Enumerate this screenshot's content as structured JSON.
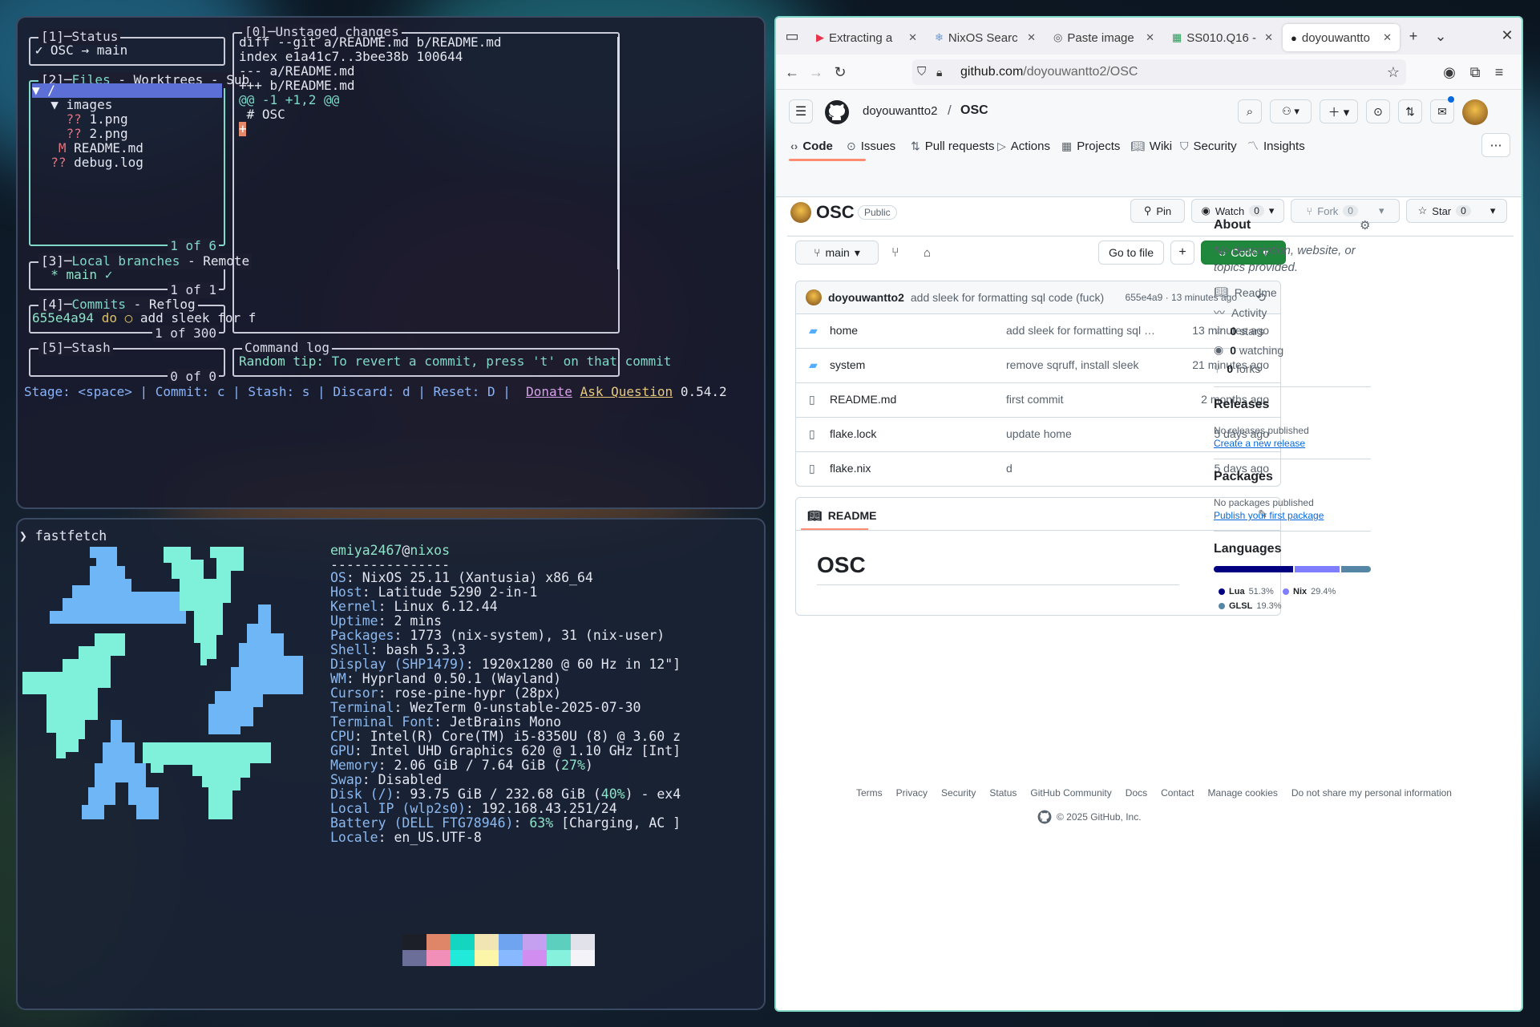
{
  "lazygit": {
    "status": {
      "title": "[1]─Status",
      "value": "✓ OSC → main"
    },
    "files": {
      "title_num": "[2]─",
      "title_active": "Files",
      "title_rest": " - Worktrees - Sub",
      "rows": [
        {
          "text": "▼ /",
          "cls": "sel"
        },
        {
          "text": "  ▼ images",
          "cls": "wh"
        },
        {
          "prefix": "    ?? ",
          "name": "1.png"
        },
        {
          "prefix": "    ?? ",
          "name": "2.png"
        },
        {
          "prefix": "   M ",
          "name": "README.md"
        },
        {
          "prefix": "  ?? ",
          "name": "debug.log"
        }
      ],
      "footer": "1 of 6"
    },
    "branches": {
      "title_num": "[3]─",
      "title_active": "Local branches",
      "title_rest": " - Remote",
      "row": "  * main ✓",
      "footer": "1 of 1"
    },
    "commits": {
      "title_num": "[4]─",
      "title_active": "Commits",
      "title_rest": " - Reflog",
      "hash": "655e4a94",
      "author": " do ",
      "circle": "○",
      "msg": " add sleek for f",
      "footer": "1 of 300"
    },
    "stash": {
      "title": "[5]─Stash",
      "footer": "0 of 0"
    },
    "diff": {
      "title": "[0]─Unstaged changes",
      "lines": [
        "diff --git a/README.md b/README.md",
        "index e1a41c7..3bee38b 100644",
        "--- a/README.md",
        "+++ b/README.md",
        "@@ -1 +1,2 @@",
        " # OSC",
        "+"
      ]
    },
    "cmdlog": {
      "title": "Command log",
      "tip_label": "Random tip: ",
      "tip": "To revert a commit, press 't' on that commit"
    },
    "statusbar": {
      "keys": "Stage: <space> | Commit: c | Stash: s | Discard: d | Reset: D | ",
      "donate": "Donate",
      "ask": "Ask Question",
      "version": "0.54.2"
    }
  },
  "fastfetch": {
    "prompt": "❯ fastfetch",
    "user": "emiya2467",
    "at": "@",
    "host": "nixos",
    "sep": "---------------",
    "rows": [
      {
        "k": "OS",
        "v": "NixOS 25.11 (Xantusia) x86_64"
      },
      {
        "k": "Host",
        "v": "Latitude 5290 2-in-1"
      },
      {
        "k": "Kernel",
        "v": "Linux 6.12.44"
      },
      {
        "k": "Uptime",
        "v": "2 mins"
      },
      {
        "k": "Packages",
        "v": "1773 (nix-system), 31 (nix-user)"
      },
      {
        "k": "Shell",
        "v": "bash 5.3.3"
      },
      {
        "k": "Display (SHP1479)",
        "v": "1920x1280 @ 60 Hz in 12\"]"
      },
      {
        "k": "WM",
        "v": "Hyprland 0.50.1 (Wayland)"
      },
      {
        "k": "Cursor",
        "v": "rose-pine-hypr (28px)"
      },
      {
        "k": "Terminal",
        "v": "WezTerm 0-unstable-2025-07-30"
      },
      {
        "k": "Terminal Font",
        "v": "JetBrains Mono"
      },
      {
        "k": "CPU",
        "v": "Intel(R) Core(TM) i5-8350U (8) @ 3.60 z"
      },
      {
        "k": "GPU",
        "v": "Intel UHD Graphics 620 @ 1.10 GHz [Int]"
      },
      {
        "k": "Memory",
        "v": "2.06 GiB / 7.64 GiB (",
        "pct": "27%",
        "tail": ")"
      },
      {
        "k": "Swap",
        "v": "Disabled"
      },
      {
        "k": "Disk (/)",
        "v": "93.75 GiB / 232.68 GiB (",
        "pct": "40%",
        "tail": ") - ex4"
      },
      {
        "k": "Local IP (wlp2s0)",
        "v": "192.168.43.251/24"
      },
      {
        "k": "Battery (DELL FTG78946)",
        "v": "",
        "pct": "63%",
        "tail": " [Charging, AC ]"
      },
      {
        "k": "Locale",
        "v": "en_US.UTF-8"
      }
    ],
    "palette_top": [
      "#1c1e28",
      "#e08668",
      "#14d6c0",
      "#f2e5b4",
      "#6ea4f0",
      "#c6a0f0",
      "#5ccfbf",
      "#e2e3ea"
    ],
    "palette_bottom": [
      "#6a6e99",
      "#f28fb8",
      "#22eadb",
      "#fbf6a8",
      "#88b8ff",
      "#d18ef0",
      "#86f2de",
      "#f4f4f8"
    ]
  },
  "browser": {
    "tabs": [
      {
        "label": "Extracting a",
        "icon": "youtube-icon"
      },
      {
        "label": "NixOS Searc",
        "icon": "nix-icon"
      },
      {
        "label": "Paste image",
        "icon": "globe-icon"
      },
      {
        "label": "SS010.Q16 -",
        "icon": "sheets-icon"
      },
      {
        "label": "doyouwantto",
        "icon": "github-icon"
      }
    ],
    "url_host": "github.com",
    "url_path": "/doyouwantto2/OSC",
    "repo": {
      "owner": "doyouwantto2",
      "sep": "/",
      "name": "OSC",
      "visibility": "Public",
      "nav": [
        "Code",
        "Issues",
        "Pull requests",
        "Actions",
        "Projects",
        "Wiki",
        "Security",
        "Insights"
      ],
      "pin": "Pin",
      "watch": "Watch",
      "watch_n": "0",
      "fork": "Fork",
      "fork_n": "0",
      "star": "Star",
      "star_n": "0",
      "branch": "main",
      "goto": "Go to file",
      "code_btn": "Code",
      "commit": {
        "author": "doyouwantto2",
        "msg": "add sleek for formatting sql code (fuck)",
        "hash": "655e4a9",
        "dot": " · ",
        "time": "13 minutes ago"
      },
      "files": [
        {
          "name": "home",
          "type": "dir",
          "msg": "add sleek for formatting sql code...",
          "time": "13 minutes ago"
        },
        {
          "name": "system",
          "type": "dir",
          "msg": "remove sqruff, install sleek",
          "time": "21 minutes ago"
        },
        {
          "name": "README.md",
          "type": "file",
          "msg": "first commit",
          "time": "2 months ago"
        },
        {
          "name": "flake.lock",
          "type": "file",
          "msg": "update home",
          "time": "5 days ago"
        },
        {
          "name": "flake.nix",
          "type": "file",
          "msg": "d",
          "time": "5 days ago"
        }
      ],
      "readme_tab": "README",
      "readme_h1": "OSC"
    },
    "about": {
      "title": "About",
      "desc": "No description, website, or topics provided.",
      "readme": "Readme",
      "activity": "Activity",
      "stars_n": "0",
      "stars": " stars",
      "watching_n": "0",
      "watching": " watching",
      "forks_n": "0",
      "forks": " forks",
      "releases_title": "Releases",
      "releases_none": "No releases published",
      "releases_link": "Create a new release",
      "packages_title": "Packages",
      "packages_none": "No packages published",
      "packages_link": "Publish your first package",
      "languages_title": "Languages",
      "languages": [
        {
          "name": "Lua",
          "pct": "51.3%",
          "value": 51.3,
          "color": "#000080"
        },
        {
          "name": "Nix",
          "pct": "29.4%",
          "value": 29.4,
          "color": "#7e7eff"
        },
        {
          "name": "GLSL",
          "pct": "19.3%",
          "value": 19.3,
          "color": "#5686a5"
        }
      ]
    },
    "footer": [
      "Terms",
      "Privacy",
      "Security",
      "Status",
      "GitHub Community",
      "Docs",
      "Contact",
      "Manage cookies",
      "Do not share my personal information"
    ],
    "copyright": "© 2025 GitHub, Inc."
  }
}
